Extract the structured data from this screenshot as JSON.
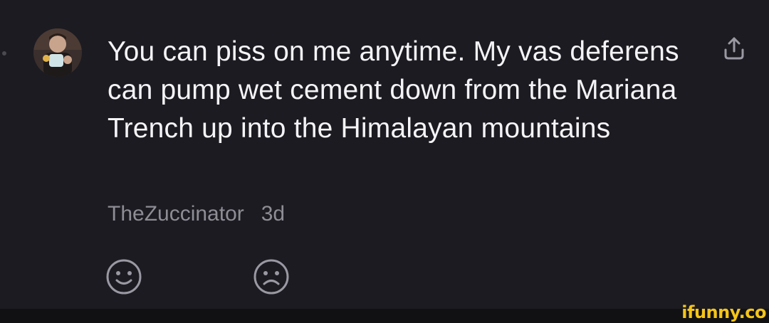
{
  "comment": {
    "text": "You can piss on me anytime. My vas deferens can pump wet cement down from the Mariana Trench up into the Himalayan mountains",
    "author": "TheZuccinator",
    "time": "3d"
  },
  "icons": {
    "share": "share-icon",
    "like": "smile-face-icon",
    "dislike": "frown-face-icon"
  },
  "watermark": {
    "text": "ifunny.co",
    "color": "#f5c518"
  },
  "colors": {
    "background": "#1c1b21",
    "text": "#f4f4f7",
    "meta": "#8e8d96",
    "icon": "#9a99a3"
  }
}
